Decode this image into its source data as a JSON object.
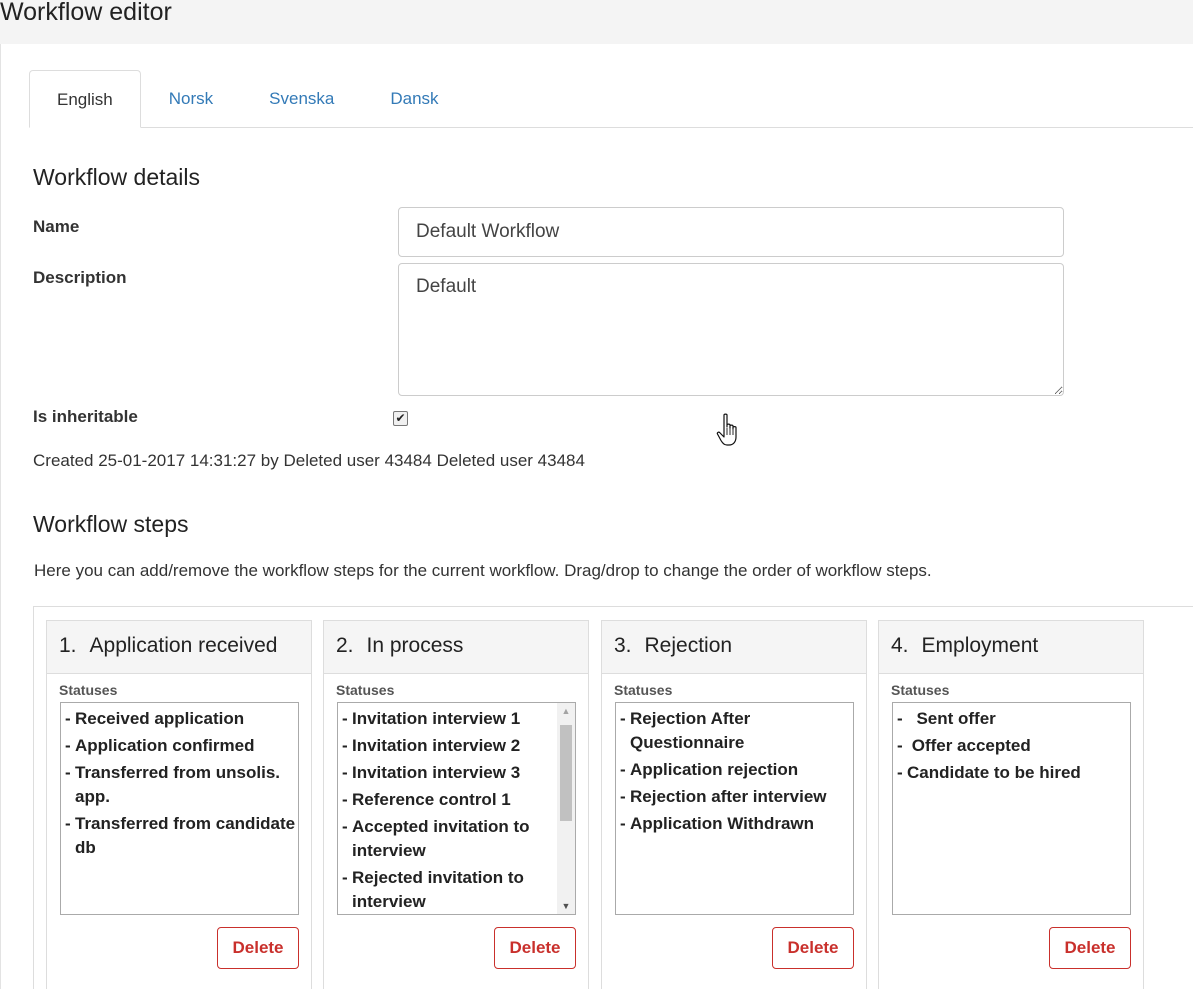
{
  "page": {
    "title": "Workflow editor"
  },
  "tabs": [
    {
      "label": "English",
      "active": true
    },
    {
      "label": "Norsk",
      "active": false
    },
    {
      "label": "Svenska",
      "active": false
    },
    {
      "label": "Dansk",
      "active": false
    }
  ],
  "details": {
    "heading": "Workflow details",
    "name_label": "Name",
    "name_value": "Default Workflow",
    "description_label": "Description",
    "description_value": "Default",
    "inheritable_label": "Is inheritable",
    "inheritable_checked": true,
    "created_text": "Created 25-01-2017 14:31:27 by Deleted user 43484 Deleted user 43484"
  },
  "steps_section": {
    "heading": "Workflow steps",
    "hint": "Here you can add/remove the workflow steps for the current workflow. Drag/drop to change the order of workflow steps.",
    "statuses_label": "Statuses",
    "delete_label": "Delete"
  },
  "steps": [
    {
      "number": "1.",
      "title": "Application received",
      "statuses": [
        "Received application",
        "Application confirmed",
        "Transferred from unsolis. app.",
        "Transferred from candidate db"
      ]
    },
    {
      "number": "2.",
      "title": "In process",
      "statuses": [
        "Invitation interview 1",
        "Invitation interview 2",
        "Invitation interview 3",
        "Reference control 1",
        "Accepted invitation to interview",
        "Rejected invitation to interview"
      ]
    },
    {
      "number": "3.",
      "title": "Rejection",
      "statuses": [
        "Rejection After Questionnaire",
        "Application rejection",
        "Rejection after interview",
        "Application Withdrawn"
      ]
    },
    {
      "number": "4.",
      "title": "Employment",
      "statuses": [
        "  Sent offer",
        " Offer accepted",
        "Candidate to be hired"
      ]
    }
  ],
  "colors": {
    "link": "#337ab7",
    "danger": "#c9302c",
    "header_bg": "#f5f5f5"
  },
  "icons": {
    "cursor": "hand-pointer-icon",
    "scroll_up": "triangle-up-icon",
    "scroll_down": "triangle-down-icon",
    "check": "checkmark-icon"
  }
}
